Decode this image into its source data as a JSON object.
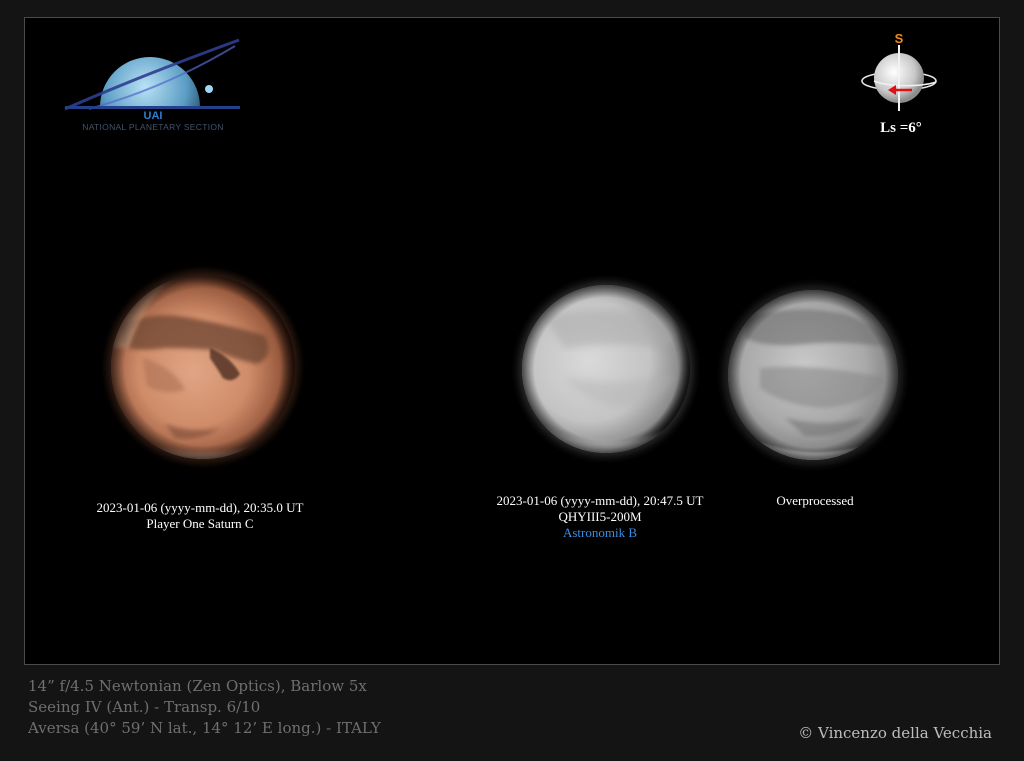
{
  "logo": {
    "acronym": "UAI",
    "section": "NATIONAL PLANETARY SECTION"
  },
  "orientation": {
    "south_marker": "S",
    "ls_label": "Ls =6°"
  },
  "images": [
    {
      "name": "color",
      "lines": [
        "2023-01-06 (yyyy-mm-dd), 20:35.0 UT",
        "Player One Saturn C"
      ]
    },
    {
      "name": "ir",
      "lines": [
        "2023-01-06 (yyyy-mm-dd), 20:47.5 UT",
        "QHYIII5-200M"
      ],
      "filter": "Astronomik B",
      "filter_color": "#3a8de0"
    },
    {
      "name": "overprocessed",
      "lines": [
        "Overprocessed"
      ]
    }
  ],
  "footer": {
    "telescope": "14” f/4.5 Newtonian (Zen Optics), Barlow 5x",
    "seeing": "Seeing  IV (Ant.) - Transp. 6/10",
    "location": "Aversa (40° 59’ N lat., 14° 12’ E long.) - ITALY",
    "copyright": "© Vincenzo della Vecchia"
  }
}
